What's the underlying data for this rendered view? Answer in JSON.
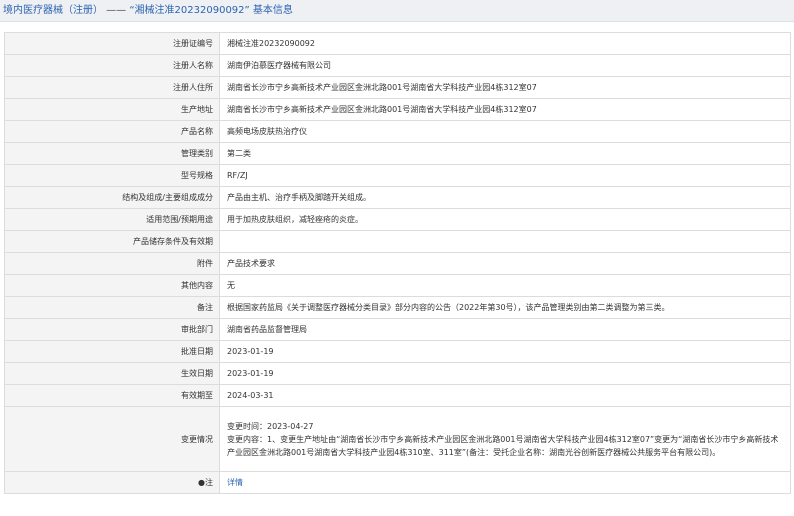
{
  "header": {
    "part1": "境内医疗器械（注册）",
    "sep": " —— ",
    "part2": "“湘械注准20232090092”",
    "part3": " 基本信息"
  },
  "rows": [
    {
      "label": "注册证编号",
      "value": "湘械注准20232090092"
    },
    {
      "label": "注册人名称",
      "value": "湖南伊泊慕医疗器械有限公司"
    },
    {
      "label": "注册人住所",
      "value": "湖南省长沙市宁乡高新技术产业园区金洲北路001号湖南省大学科技产业园4栋312室07"
    },
    {
      "label": "生产地址",
      "value": "湖南省长沙市宁乡高新技术产业园区金洲北路001号湖南省大学科技产业园4栋312室07"
    },
    {
      "label": "产品名称",
      "value": "高频电场皮肤热治疗仪"
    },
    {
      "label": "管理类别",
      "value": "第二类"
    },
    {
      "label": "型号规格",
      "value": "RF/ZJ"
    },
    {
      "label": "结构及组成/主要组成成分",
      "value": "产品由主机、治疗手柄及脚踏开关组成。"
    },
    {
      "label": "适用范围/预期用途",
      "value": "用于加热皮肤组织，减轻痤疮的炎症。"
    },
    {
      "label": "产品储存条件及有效期",
      "value": ""
    },
    {
      "label": "附件",
      "value": "产品技术要求"
    },
    {
      "label": "其他内容",
      "value": "无"
    },
    {
      "label": "备注",
      "value": "根据国家药监局《关于调整医疗器械分类目录》部分内容的公告（2022年第30号），该产品管理类别由第二类调整为第三类。"
    },
    {
      "label": "审批部门",
      "value": "湖南省药品监督管理局"
    },
    {
      "label": "批准日期",
      "value": "2023-01-19"
    },
    {
      "label": "生效日期",
      "value": "2023-01-19"
    },
    {
      "label": "有效期至",
      "value": "2024-03-31"
    }
  ],
  "change": {
    "label": "变更情况",
    "line1": "变更时间：2023-04-27",
    "line2": "变更内容：1、变更生产地址由“湖南省长沙市宁乡高新技术产业园区金洲北路001号湖南省大学科技产业园4栋312室07”变更为“湖南省长沙市宁乡高新技术产业园区金洲北路001号湖南省大学科技产业园4栋310室、311室”(备注：受托企业名称：湖南光谷创新医疗器械公共服务平台有限公司)。"
  },
  "note": {
    "label": "●注",
    "link": "详情"
  }
}
